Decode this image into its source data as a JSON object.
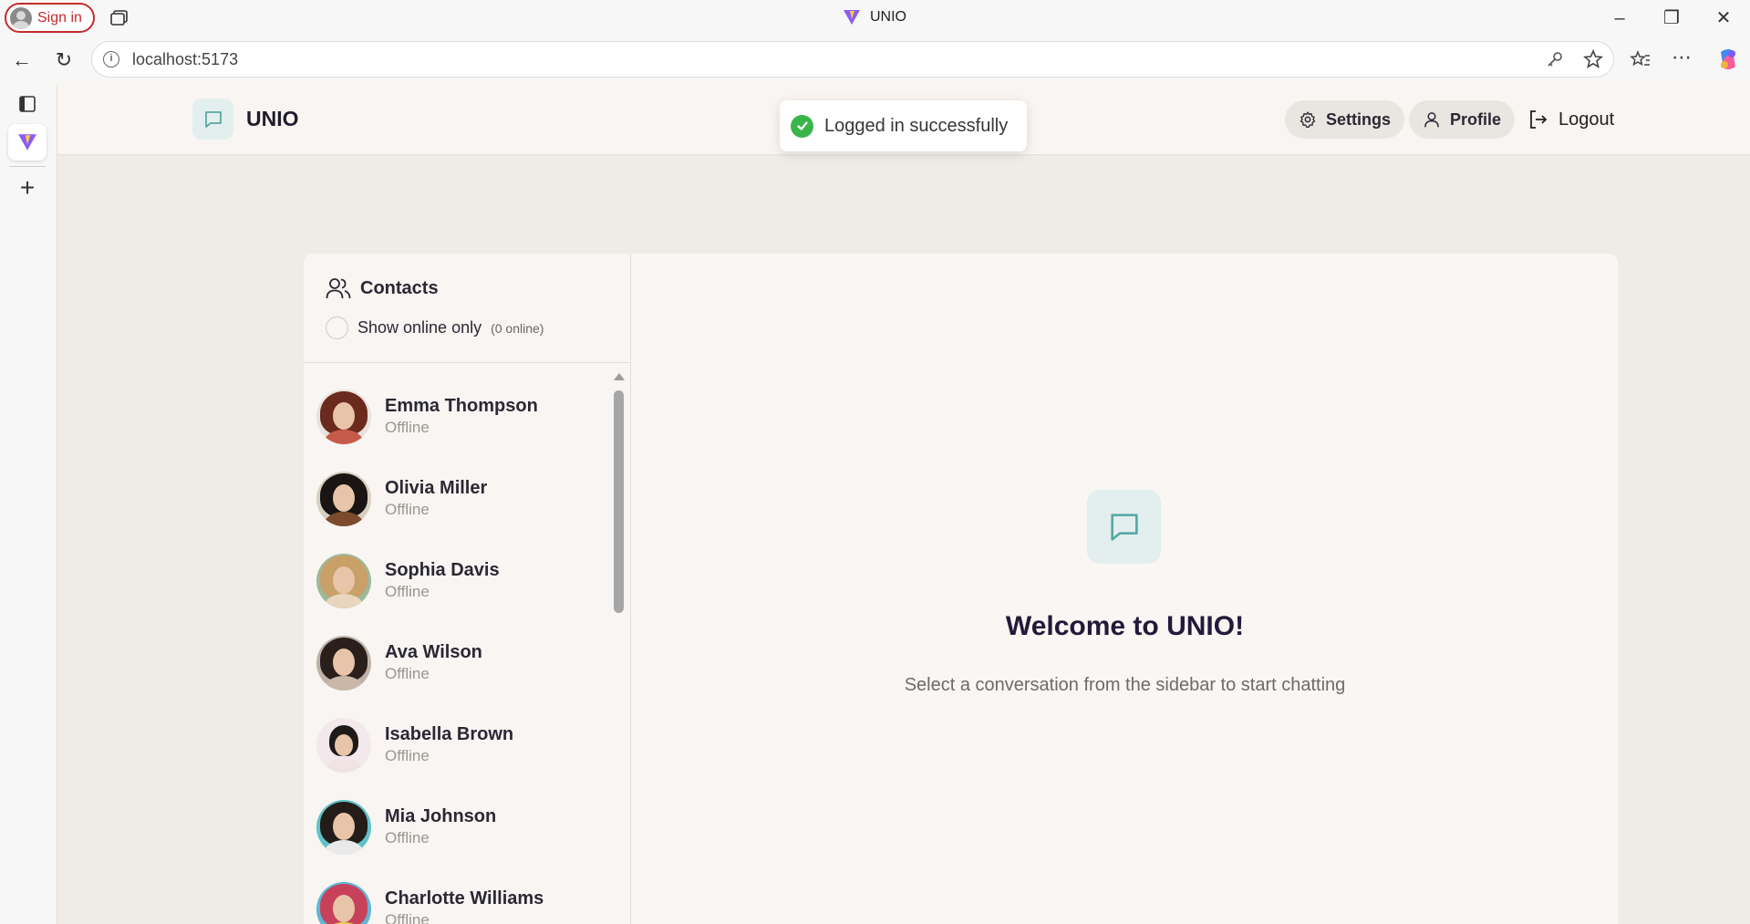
{
  "browser": {
    "signin_label": "Sign in",
    "tab_title": "UNIO",
    "url": "localhost:5173"
  },
  "app": {
    "brand": "UNIO",
    "nav": {
      "settings": "Settings",
      "profile": "Profile",
      "logout": "Logout"
    },
    "toast": "Logged in successfully",
    "contacts": {
      "title": "Contacts",
      "filter_label": "Show online only",
      "online_count": "(0 online)",
      "items": [
        {
          "name": "Emma Thompson",
          "status": "Offline",
          "hair": "#6b2a1e",
          "body": "#c65a4a"
        },
        {
          "name": "Olivia Miller",
          "status": "Offline",
          "hair": "#1a1512",
          "body": "#7c4b2d"
        },
        {
          "name": "Sophia Davis",
          "status": "Offline",
          "hair": "#c8a068",
          "body": "#e9d6be"
        },
        {
          "name": "Ava Wilson",
          "status": "Offline",
          "hair": "#2a1f1b",
          "body": "#c9b8a8"
        },
        {
          "name": "Isabella Brown",
          "status": "Offline",
          "hair": "#1e1a1a",
          "body": "#f0e3e6"
        },
        {
          "name": "Mia Johnson",
          "status": "Offline",
          "hair": "#231c19",
          "body": "#5fc2c7"
        },
        {
          "name": "Charlotte Williams",
          "status": "Offline",
          "hair": "#c8415a",
          "body": "#5fb6d6"
        }
      ]
    },
    "welcome": {
      "title": "Welcome to UNIO!",
      "subtitle": "Select a conversation from the sidebar to start chatting"
    }
  },
  "colors": {
    "accent": "#5aa8a3",
    "success": "#3bb54a"
  }
}
